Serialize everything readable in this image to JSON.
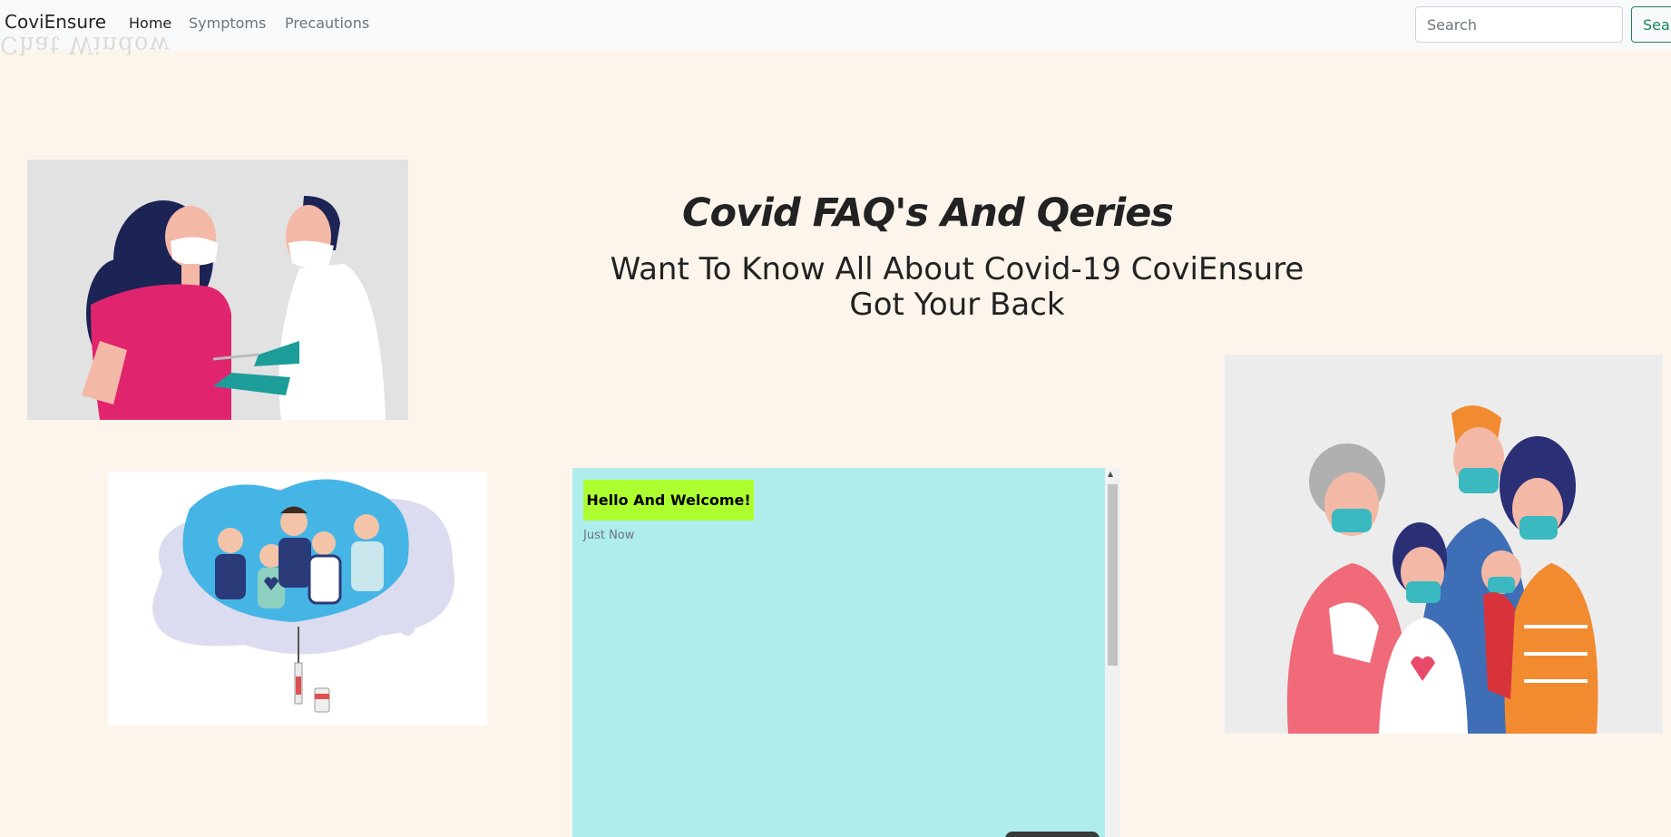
{
  "navbar": {
    "brand": "CoviEnsure",
    "links": [
      {
        "label": "Home",
        "active": true
      },
      {
        "label": "Symptoms",
        "active": false
      },
      {
        "label": "Precautions",
        "active": false
      }
    ],
    "overlay_text": "Chat Window",
    "search": {
      "placeholder": "Search",
      "button_label": "Sea"
    }
  },
  "hero": {
    "title": "Covid FAQ's And Qeries",
    "subtitle": "Want To Know All About Covid-19 CoviEnsure Got Your Back"
  },
  "chat": {
    "message": "Hello And Welcome!",
    "time": "Just Now"
  },
  "colors": {
    "page_background": "#fdf5ec",
    "chat_background": "#afecec",
    "bubble_background": "#adff2f",
    "search_button_border": "#198754"
  }
}
